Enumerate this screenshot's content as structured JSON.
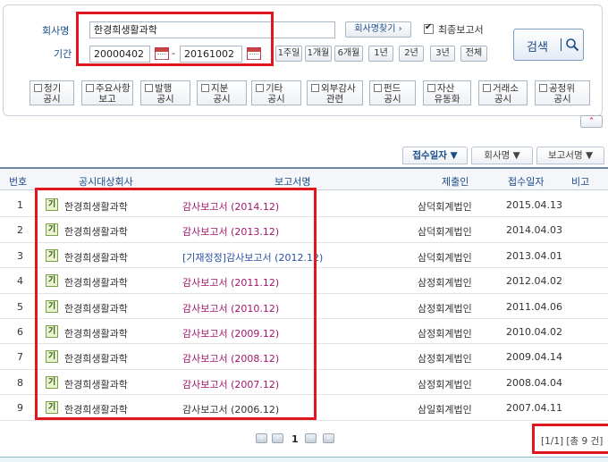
{
  "search": {
    "company_label": "회사명",
    "company_value": "한경희생활과학",
    "find_company_button": "회사명찾기 ›",
    "final_report_label": "최종보고서",
    "period_label": "기간",
    "date_from": "20000402",
    "date_separator": "-",
    "date_to": "20161002",
    "period_buttons": [
      "1주일",
      "1개월",
      "6개월",
      "1년",
      "2년",
      "3년",
      "전체"
    ],
    "search_button": "검색",
    "categories": [
      {
        "l1": "정기",
        "l2": "공시"
      },
      {
        "l1": "주요사항",
        "l2": "보고"
      },
      {
        "l1": "발행",
        "l2": "공시"
      },
      {
        "l1": "지분",
        "l2": "공시"
      },
      {
        "l1": "기타",
        "l2": "공시"
      },
      {
        "l1": "외부감사",
        "l2": "관련"
      },
      {
        "l1": "펀드",
        "l2": "공시"
      },
      {
        "l1": "자산",
        "l2": "유동화"
      },
      {
        "l1": "거래소",
        "l2": "공시"
      },
      {
        "l1": "공정위",
        "l2": "공시"
      }
    ],
    "collapse_icon": "chevron-up-icon"
  },
  "sort_tabs": [
    {
      "label": "접수일자 ▼",
      "active": true
    },
    {
      "label": "회사명 ▼",
      "active": false
    },
    {
      "label": "보고서명 ▼",
      "active": false
    }
  ],
  "table": {
    "headers": [
      "번호",
      "공시대상회사",
      "보고서명",
      "제출인",
      "접수일자",
      "비고"
    ],
    "market_badge": "기",
    "rows": [
      {
        "no": "1",
        "company": "한경희생활과학",
        "report": "감사보고서 (2014.12)",
        "submitter": "삼덕회계법인",
        "date": "2015.04.13",
        "note": ""
      },
      {
        "no": "2",
        "company": "한경희생활과학",
        "report": "감사보고서 (2013.12)",
        "submitter": "삼덕회계법인",
        "date": "2014.04.03",
        "note": ""
      },
      {
        "no": "3",
        "company": "한경희생활과학",
        "report": "[기재정정]감사보고서 (2012.12)",
        "submitter": "삼덕회계법인",
        "date": "2013.04.01",
        "note": ""
      },
      {
        "no": "4",
        "company": "한경희생활과학",
        "report": "감사보고서 (2011.12)",
        "submitter": "삼정회계법인",
        "date": "2012.04.02",
        "note": ""
      },
      {
        "no": "5",
        "company": "한경희생활과학",
        "report": "감사보고서 (2010.12)",
        "submitter": "삼정회계법인",
        "date": "2011.04.06",
        "note": ""
      },
      {
        "no": "6",
        "company": "한경희생활과학",
        "report": "감사보고서 (2009.12)",
        "submitter": "삼정회계법인",
        "date": "2010.04.02",
        "note": ""
      },
      {
        "no": "7",
        "company": "한경희생활과학",
        "report": "감사보고서 (2008.12)",
        "submitter": "삼정회계법인",
        "date": "2009.04.14",
        "note": ""
      },
      {
        "no": "8",
        "company": "한경희생활과학",
        "report": "감사보고서 (2007.12)",
        "submitter": "삼정회계법인",
        "date": "2008.04.04",
        "note": ""
      },
      {
        "no": "9",
        "company": "한경희생활과학",
        "report": "감사보고서 (2006.12)",
        "submitter": "삼일회계법인",
        "date": "2007.04.11",
        "note": ""
      }
    ]
  },
  "pagination": {
    "current_page": "1",
    "summary": "[1/1] [총 9 건]"
  },
  "colors": {
    "highlight": "#e0181e",
    "report_link": "#a0166b",
    "accent": "#1a4c8a"
  }
}
